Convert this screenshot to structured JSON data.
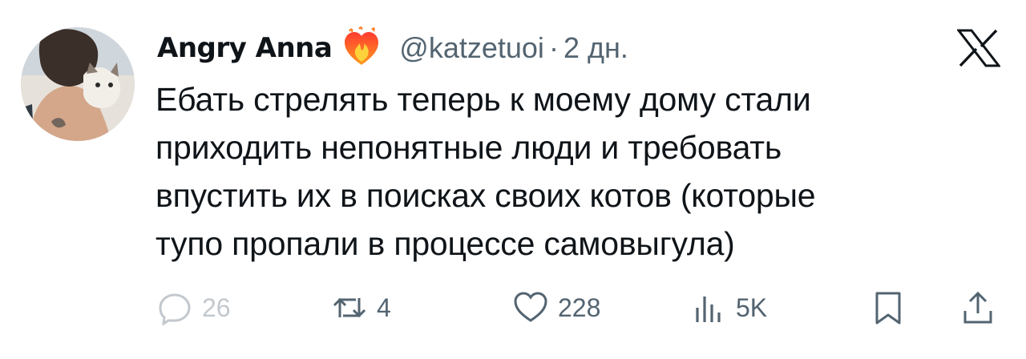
{
  "author": {
    "name": "Angry Anna",
    "handle": "@katzetuoi",
    "separator": "·",
    "time": "2 дн."
  },
  "tweet": {
    "lines": [
      "Ебать стрелять теперь к моему дому стали",
      "приходить непонятные люди и требовать",
      "впустить их в поисках своих котов (которые",
      "тупо пропали в процессе самовыгула)"
    ]
  },
  "stats": {
    "replies": "26",
    "retweets": "4",
    "likes": "228",
    "views": "5K"
  },
  "icons": {
    "platform": "x-logo-icon",
    "badge": "fire-heart-icon",
    "reply": "reply-icon",
    "retweet": "retweet-icon",
    "like": "heart-icon",
    "views": "views-icon",
    "bookmark": "bookmark-icon",
    "share": "share-icon"
  },
  "colors": {
    "text": "#0f1419",
    "secondary": "#536471",
    "background": "#ffffff"
  }
}
